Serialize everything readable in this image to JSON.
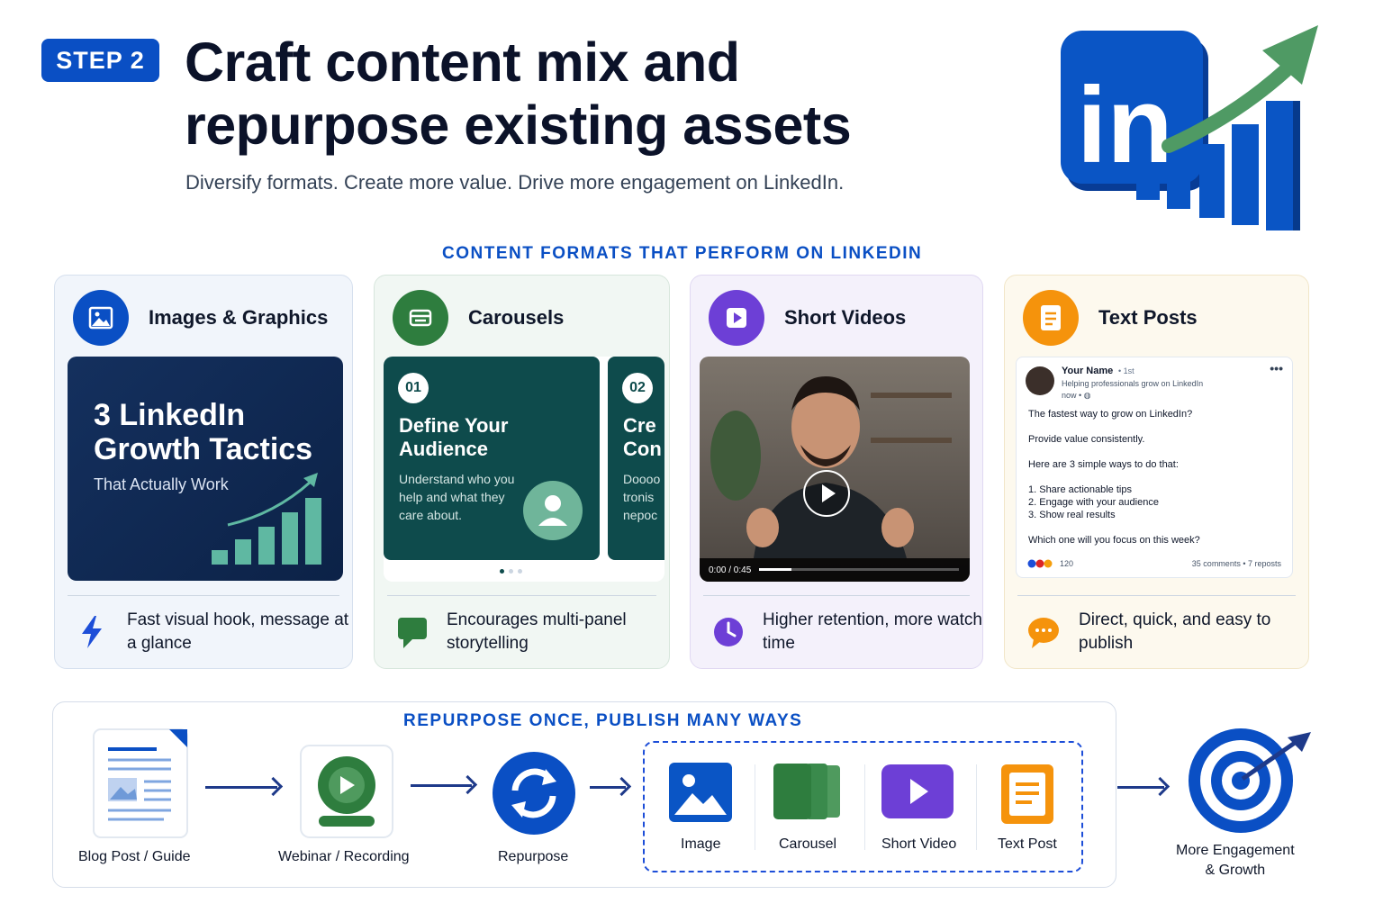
{
  "header": {
    "step_badge": "STEP 2",
    "title_line1": "Craft content mix and",
    "title_line2": "repurpose existing assets",
    "subtitle": "Diversify formats. Create more value. Drive more engagement on LinkedIn."
  },
  "hero": {
    "logo_text": "in",
    "logo_color": "#0a55c5",
    "arrow_color": "#4f9a64"
  },
  "formats": {
    "section_label": "CONTENT FORMATS THAT PERFORM ON LINKEDIN",
    "cards": [
      {
        "title": "Images & Graphics",
        "icon": "image-icon",
        "accent": "#0a4fc4",
        "visual": {
          "headline": "3 LinkedIn Growth Tactics",
          "subline": "That Actually Work"
        },
        "foot_icon": "lightning-icon",
        "benefit": "Fast visual hook, message at a glance"
      },
      {
        "title": "Carousels",
        "icon": "carousel-icon",
        "accent": "#2e7d3e",
        "visual": {
          "slide1_num": "01",
          "slide1_title": "Define Your Audience",
          "slide1_text": "Understand who you help and what they care about.",
          "slide2_num": "02",
          "slide2_title": "Cre Con",
          "slide2_text": "Doooo tronis nepoc"
        },
        "foot_icon": "chat-icon",
        "benefit": "Encourages multi-panel storytelling"
      },
      {
        "title": "Short Videos",
        "icon": "play-icon",
        "accent": "#6d3fd6",
        "visual": {
          "time": "0:00 / 0:45",
          "progress": 0.16
        },
        "foot_icon": "clock-icon",
        "benefit": "Higher retention, more watch time"
      },
      {
        "title": "Text Posts",
        "icon": "document-icon",
        "accent": "#f5930c",
        "post": {
          "name": "Your Name",
          "degree": "• 1st",
          "headline": "Helping professionals grow on LinkedIn",
          "time": "now • ◍",
          "more": "•••",
          "lines": [
            "The fastest way to grow on LinkedIn?",
            "Provide value consistently.",
            "Here are 3 simple ways to do that:",
            "1. Share actionable tips",
            "2. Engage with your audience",
            "3. Show real results",
            "Which one will you focus on this week?"
          ],
          "reactions": "120",
          "stats": "35 comments • 7 reposts"
        },
        "foot_icon": "speech-bubble-icon",
        "benefit": "Direct, quick, and easy to publish"
      }
    ]
  },
  "repurpose": {
    "section_label": "REPURPOSE ONCE, PUBLISH MANY WAYS",
    "sources": [
      {
        "label": "Blog Post / Guide",
        "icon": "document-icon"
      },
      {
        "label": "Webinar / Recording",
        "icon": "webcam-icon"
      }
    ],
    "hub": {
      "label": "Repurpose",
      "icon": "refresh-icon"
    },
    "outputs": [
      {
        "label": "Image",
        "icon": "image-icon",
        "color": "#0a55c5"
      },
      {
        "label": "Carousel",
        "icon": "carousel-icon",
        "color": "#2e7d3e"
      },
      {
        "label": "Short Video",
        "icon": "play-icon",
        "color": "#6d3fd6"
      },
      {
        "label": "Text Post",
        "icon": "document-icon",
        "color": "#f5930c"
      }
    ],
    "result": {
      "label_line1": "More Engagement",
      "label_line2": "& Growth",
      "icon": "target-icon"
    }
  }
}
